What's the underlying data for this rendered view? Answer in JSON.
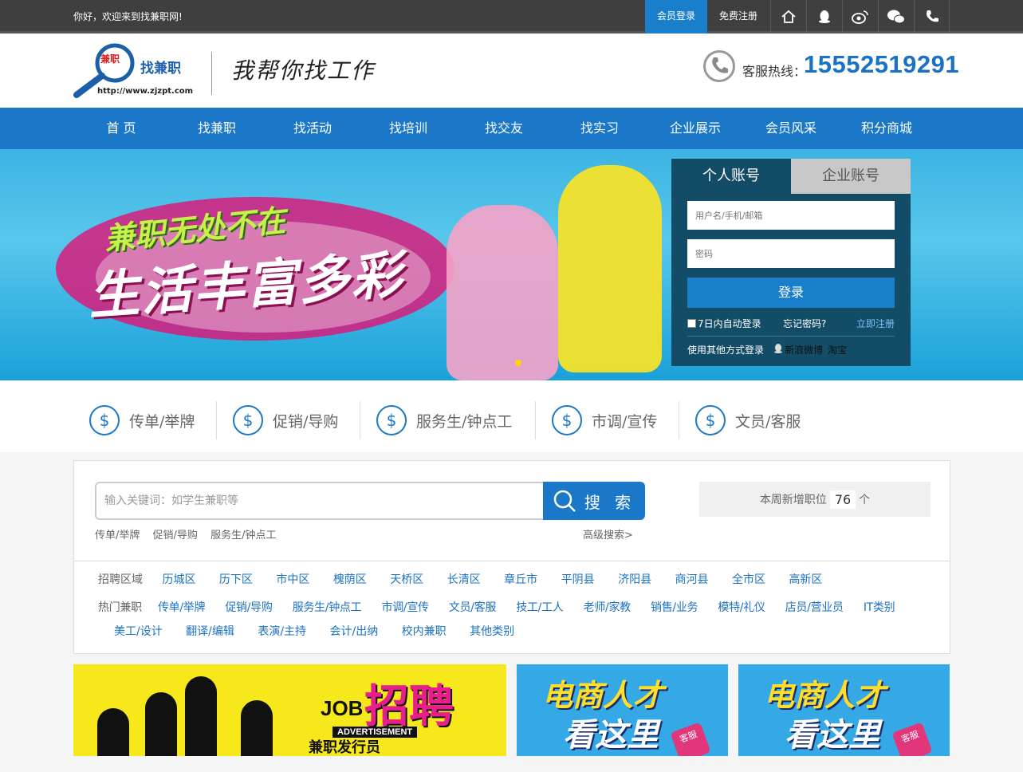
{
  "topbar": {
    "welcome": "你好，欢迎来到找兼职网!",
    "login": "会员登录",
    "register": "免费注册",
    "icons": [
      "home-icon",
      "qq-icon",
      "weibo-icon",
      "wechat-icon",
      "phone-icon"
    ]
  },
  "header": {
    "logo_badge": "兼职",
    "logo_brand": "找兼职",
    "logo_domain": "http://www.zjzpt.com",
    "slogan": "我帮你找工作",
    "hotline_label": "客服热线：",
    "hotline_number": "15552519291"
  },
  "nav": [
    "首 页",
    "找兼职",
    "找活动",
    "找培训",
    "找交友",
    "找实习",
    "企业展示",
    "会员风采",
    "积分商城"
  ],
  "banner": {
    "line1": "兼职无处不在",
    "line2": "生活丰富多彩"
  },
  "login": {
    "tab_personal": "个人账号",
    "tab_company": "企业账号",
    "username_placeholder": "用户名/手机/邮箱",
    "password_placeholder": "密码",
    "submit": "登录",
    "remember": "7日内自动登录",
    "forgot": "忘记密码?",
    "register_now": "立即注册",
    "other_login": "使用其他方式登录",
    "weibo": "新浪微博",
    "taobao": "淘宝"
  },
  "categories": [
    "传单/举牌",
    "促销/导购",
    "服务生/钟点工",
    "市调/宣传",
    "文员/客服"
  ],
  "search": {
    "placeholder": "输入关键词：如学生兼职等",
    "button": "搜 索",
    "hot_keywords": [
      "传单/举牌",
      "促销/导购",
      "服务生/钟点工"
    ],
    "advanced": "高级搜索>",
    "new_jobs_prefix": "本周新增职位",
    "new_jobs_count": "76",
    "new_jobs_suffix": "个"
  },
  "areas": {
    "title": "招聘区域",
    "items": [
      "历城区",
      "历下区",
      "市中区",
      "槐荫区",
      "天桥区",
      "长清区",
      "章丘市",
      "平阴县",
      "济阳县",
      "商河县",
      "全市区",
      "高新区"
    ]
  },
  "hot_jobs": {
    "title": "热门兼职",
    "items": [
      "传单/举牌",
      "促销/导购",
      "服务生/钟点工",
      "市调/宣传",
      "文员/客服",
      "技工/工人",
      "老师/家教",
      "销售/业务",
      "模特/礼仪",
      "店员/营业员",
      "IT类别"
    ],
    "items2": [
      "美工/设计",
      "翻译/编辑",
      "表演/主持",
      "会计/出纳",
      "校内兼职",
      "其他类别"
    ]
  },
  "ads": {
    "ad1_job": "JOB",
    "ad1_title": "招聘",
    "ad1_adv": "ADVERTISEMENT",
    "ad1_sub": "兼职发行员",
    "ad2_line1": "电商人才",
    "ad2_line2": "看这里",
    "ad2_tag": "客服"
  }
}
